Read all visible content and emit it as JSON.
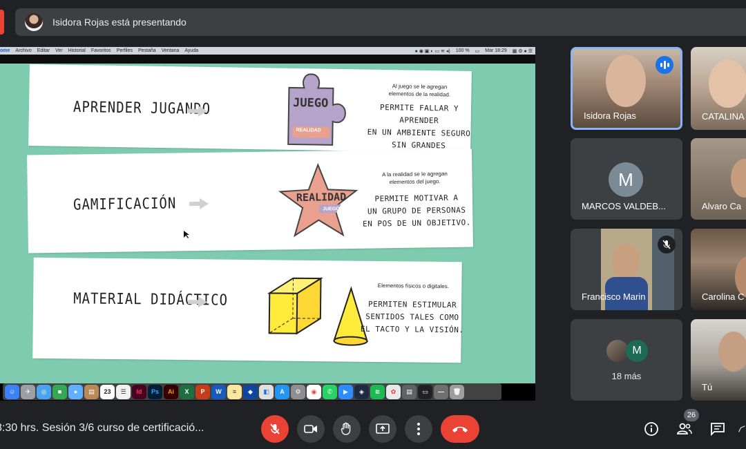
{
  "presenter_bar": {
    "text": "Isidora Rojas está presentando"
  },
  "mac_menubar": {
    "items": [
      "ome",
      "Archivo",
      "Editar",
      "Ver",
      "Historial",
      "Favoritos",
      "Perfiles",
      "Pestaña",
      "Ventana",
      "Ayuda"
    ],
    "battery": "100 %",
    "clock": "Mar 18:29"
  },
  "slide": {
    "rows": [
      {
        "label": "APRENDER JUGANDO",
        "graphic_text": "JUEGO",
        "graphic_subtext": "REALIDAD",
        "note": [
          "Al juego se le agregan",
          "elementos de la realidad."
        ],
        "description": [
          "PERMITE FALLAR Y APRENDER",
          "EN UN AMBIENTE SEGURO",
          "SIN GRANDES CONSECUENCIAS."
        ]
      },
      {
        "label": "GAMIFICACIÓN",
        "graphic_text": "REALIDAD",
        "graphic_subtext": "JUEGO",
        "note": [
          "A la realidad se le agregan",
          "elementos del juego."
        ],
        "description": [
          "PERMITE MOTIVAR A",
          "UN GRUPO DE PERSONAS",
          "EN POS DE UN OBJETIVO."
        ]
      },
      {
        "label": "MATERIAL DIDÁCTICO",
        "note": [
          "Elementos físicos o digitales."
        ],
        "description": [
          "PERMITEN ESTIMULAR",
          "SENTIDOS TALES COMO",
          "EL TACTO Y LA VISIÓN."
        ]
      }
    ]
  },
  "dock": {
    "calendar_day": "23",
    "indesign": "Id",
    "photoshop": "Ps",
    "illustrator": "Ai"
  },
  "participants": [
    {
      "name": "Isidora Rojas",
      "state": "speaking"
    },
    {
      "name": "CATALINA"
    },
    {
      "name": "MARCOS VALDEB...",
      "initial": "M"
    },
    {
      "name": "Alvaro Ca"
    },
    {
      "name": "Francisco Marin",
      "state": "muted"
    },
    {
      "name": "Carolina C"
    },
    {
      "label": "18 más",
      "initial": "M"
    },
    {
      "name": "Tú"
    }
  ],
  "bottom_bar": {
    "meeting_title": "8:30 hrs. Sesión 3/6 curso de certificació...",
    "people_count": "26"
  },
  "colors": {
    "background": "#202124",
    "tile": "#3c4043",
    "accent_blue": "#8ab4f8",
    "end_call_red": "#ea4335",
    "slide_green": "#7ecbb0",
    "puzzle_purple": "#b6a3c9",
    "star_salmon": "#e9a08f",
    "cube_yellow": "#ffeb3b"
  }
}
